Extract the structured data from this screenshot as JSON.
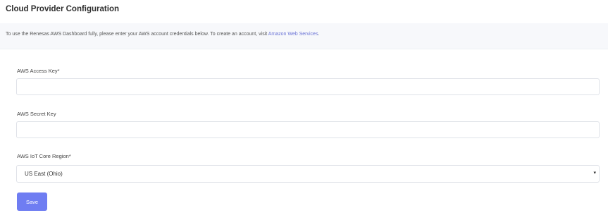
{
  "page": {
    "title": "Cloud Provider Configuration"
  },
  "banner": {
    "text": "To use the Renesas AWS Dashboard fully, please enter your AWS account credentials below. To create an account, visit ",
    "link_text": "Amazon Web Services",
    "link_suffix": "."
  },
  "form": {
    "access_key": {
      "label": "AWS Access Key*",
      "value": "",
      "placeholder": ""
    },
    "secret_key": {
      "label": "AWS Secret Key",
      "value": "",
      "placeholder": ""
    },
    "region": {
      "label": "AWS IoT Core Region*",
      "selected": "US East (Ohio)"
    },
    "save_label": "Save"
  },
  "icons": {
    "region_dropdown": "caret-down-icon"
  },
  "colors": {
    "accent": "#6f7df2",
    "link": "#6b74d6",
    "banner_bg": "#f7f8fb"
  }
}
